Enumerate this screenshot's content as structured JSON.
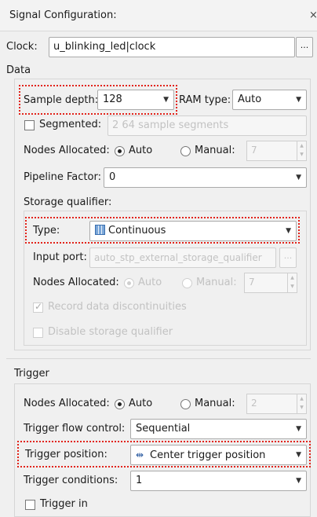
{
  "window": {
    "title": "Signal Configuration:",
    "close_symbol": "×"
  },
  "clock": {
    "label": "Clock:",
    "value": "u_blinking_led|clock",
    "browse_label": "..."
  },
  "data_section": {
    "label": "Data",
    "sample_depth": {
      "label": "Sample depth:",
      "value": "128"
    },
    "ram_type": {
      "label": "RAM type:",
      "value": "Auto"
    },
    "segmented": {
      "label": "Segmented:",
      "checked": false,
      "value": "2  64 sample segments"
    },
    "nodes_allocated": {
      "label": "Nodes Allocated:",
      "auto_label": "Auto",
      "manual_label": "Manual:",
      "manual_value": "7",
      "selected": "auto"
    },
    "pipeline_factor": {
      "label": "Pipeline Factor:",
      "value": "0"
    },
    "storage_qualifier": {
      "label": "Storage qualifier:",
      "type": {
        "label": "Type:",
        "value": "Continuous",
        "icon": "continuous-grid-icon"
      },
      "input_port": {
        "label": "Input port:",
        "value": "auto_stp_external_storage_qualifier",
        "browse_label": "..."
      },
      "nodes_allocated": {
        "label": "Nodes Allocated:",
        "auto_label": "Auto",
        "manual_label": "Manual:",
        "manual_value": "7",
        "selected": "auto"
      },
      "record_discontinuities": {
        "label": "Record data discontinuities",
        "checked": true
      },
      "disable_storage_qualifier": {
        "label": "Disable storage qualifier",
        "checked": false
      }
    }
  },
  "trigger_section": {
    "label": "Trigger",
    "nodes_allocated": {
      "label": "Nodes Allocated:",
      "auto_label": "Auto",
      "manual_label": "Manual:",
      "manual_value": "2",
      "selected": "auto"
    },
    "flow_control": {
      "label": "Trigger flow control:",
      "value": "Sequential"
    },
    "position": {
      "label": "Trigger position:",
      "value": "Center trigger position",
      "icon": "center-trigger-icon"
    },
    "conditions": {
      "label": "Trigger conditions:",
      "value": "1"
    },
    "trigger_in": {
      "label": "Trigger in",
      "checked": false
    }
  },
  "colors": {
    "highlight_border": "#e2231a",
    "disabled_text": "#c2c2c2",
    "background": "#f0f0f0"
  }
}
